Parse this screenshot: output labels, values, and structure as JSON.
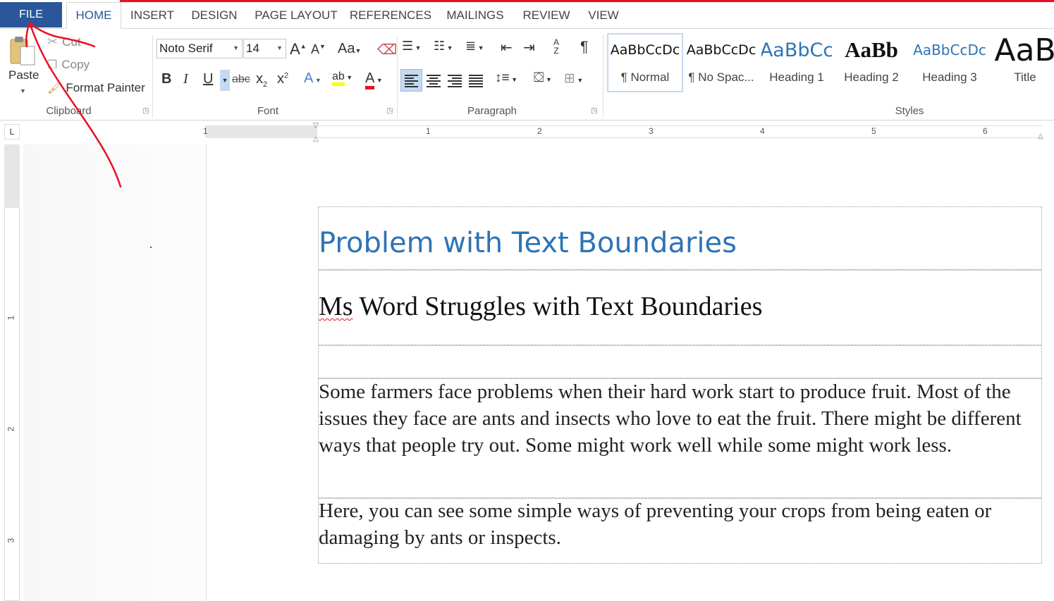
{
  "tabs": {
    "file": "FILE",
    "items": [
      "HOME",
      "INSERT",
      "DESIGN",
      "PAGE LAYOUT",
      "REFERENCES",
      "MAILINGS",
      "REVIEW",
      "VIEW"
    ]
  },
  "clipboard": {
    "paste": "Paste",
    "cut": "Cut",
    "copy": "Copy",
    "format_painter": "Format Painter",
    "label": "Clipboard"
  },
  "font": {
    "name": "Noto Serif",
    "size": "14",
    "grow": "A",
    "shrink": "A",
    "case": "Aa",
    "bold": "B",
    "italic": "I",
    "underline": "U",
    "strike": "abc",
    "sub": "x",
    "sub_mark": "2",
    "sup": "x",
    "sup_mark": "2",
    "effects": "A",
    "highlight": "ab",
    "color": "A",
    "label": "Font"
  },
  "paragraph": {
    "label": "Paragraph",
    "sort_top": "A",
    "sort_bottom": "Z",
    "pilcrow": "¶"
  },
  "styles": {
    "label": "Styles",
    "items": [
      {
        "sample": "AaBbCcDc",
        "name": "¶ Normal"
      },
      {
        "sample": "AaBbCcDc",
        "name": "¶ No Spac..."
      },
      {
        "sample": "AaBbCc",
        "name": "Heading 1"
      },
      {
        "sample": "AaBb",
        "name": "Heading 2"
      },
      {
        "sample": "AaBbCcDc",
        "name": "Heading 3"
      },
      {
        "sample": "AaB",
        "name": "Title"
      }
    ]
  },
  "ruler": {
    "h": [
      "1",
      "1",
      "2",
      "3",
      "4",
      "5",
      "6"
    ],
    "v": [
      "1",
      "2",
      "3"
    ],
    "tab_selector": "L"
  },
  "document": {
    "title": "Problem with Text Boundaries",
    "subtitle_first": "Ms",
    "subtitle_rest": " Word Struggles with Text Boundaries",
    "para1": "Some farmers face problems when their hard work start to produce fruit. Most of the issues they face are ants and insects who love to eat the fruit. There might be different ways that people try out. Some might work well while some might work less.",
    "para2": "Here, you can see some simple ways of preventing your crops from being eaten or damaging by ants or inspects."
  },
  "colors": {
    "file_tab": "#2b579a",
    "annotation": "#e81123",
    "heading": "#2e74b5"
  }
}
